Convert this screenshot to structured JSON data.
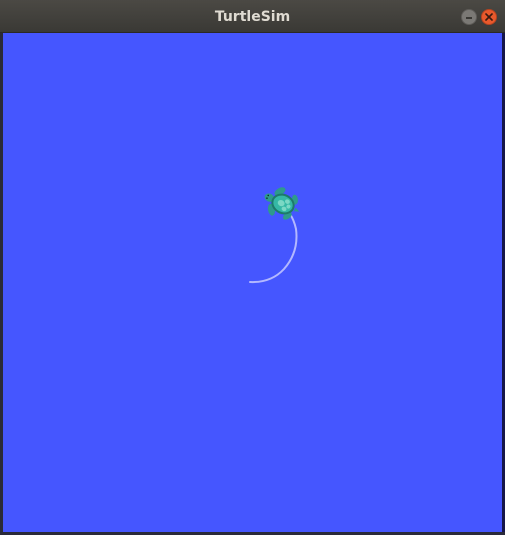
{
  "window": {
    "title": "TurtleSim"
  },
  "canvas": {
    "background_color": "#4556ff",
    "pen_color": "#b3b8ff",
    "turtle_icon": "turtle-icon"
  },
  "controls": {
    "minimize_icon": "minimize-icon",
    "close_icon": "close-icon"
  }
}
